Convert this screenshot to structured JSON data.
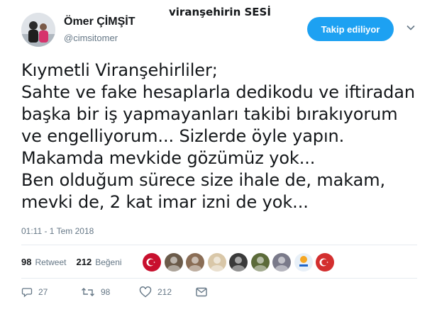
{
  "header": {
    "watermark": "viranşehirin SESİ",
    "name": "Ömer ÇİMŞİT",
    "handle": "@cimsitomer",
    "follow_label": "Takip ediliyor"
  },
  "tweet": {
    "lines": [
      "Kıymetli Viranşehirliler;",
      "Sahte ve fake hesaplarla dedikodu ve iftiradan",
      "başka bir iş yapmayanları takibi bırakıyorum",
      "ve engelliyorum... Sizlerde öyle yapın.",
      "Makamda mevkide gözümüz yok...",
      "Ben olduğum sürece size ihale de, makam,",
      "mevki de, 2 kat imar izni de yok..."
    ],
    "timestamp": "01:11 - 1 Tem 2018"
  },
  "stats": {
    "retweet_count": "98",
    "retweet_label": "Retweet",
    "like_count": "212",
    "like_label": "Beğeni"
  },
  "likers": [
    {
      "icon": "turkish-flag-avatar",
      "bg": "#c8102e"
    },
    {
      "icon": "person-avatar",
      "bg": "#6b5b4a"
    },
    {
      "icon": "person-avatar",
      "bg": "#8a6d55"
    },
    {
      "icon": "person-avatar",
      "bg": "#d9c7a8"
    },
    {
      "icon": "person-avatar",
      "bg": "#3a3a3a"
    },
    {
      "icon": "person-avatar",
      "bg": "#5c6b3a"
    },
    {
      "icon": "person-avatar",
      "bg": "#7a7a8a"
    },
    {
      "icon": "party-logo-avatar",
      "bg": "#e8f0f8"
    },
    {
      "icon": "turkish-flag-avatar",
      "bg": "#d32f2f"
    }
  ],
  "actions": {
    "reply_count": "27",
    "retweet_count": "98",
    "like_count": "212"
  },
  "colors": {
    "accent": "#1da1f2",
    "secondary_text": "#657786",
    "divider": "#e6ecf0"
  }
}
